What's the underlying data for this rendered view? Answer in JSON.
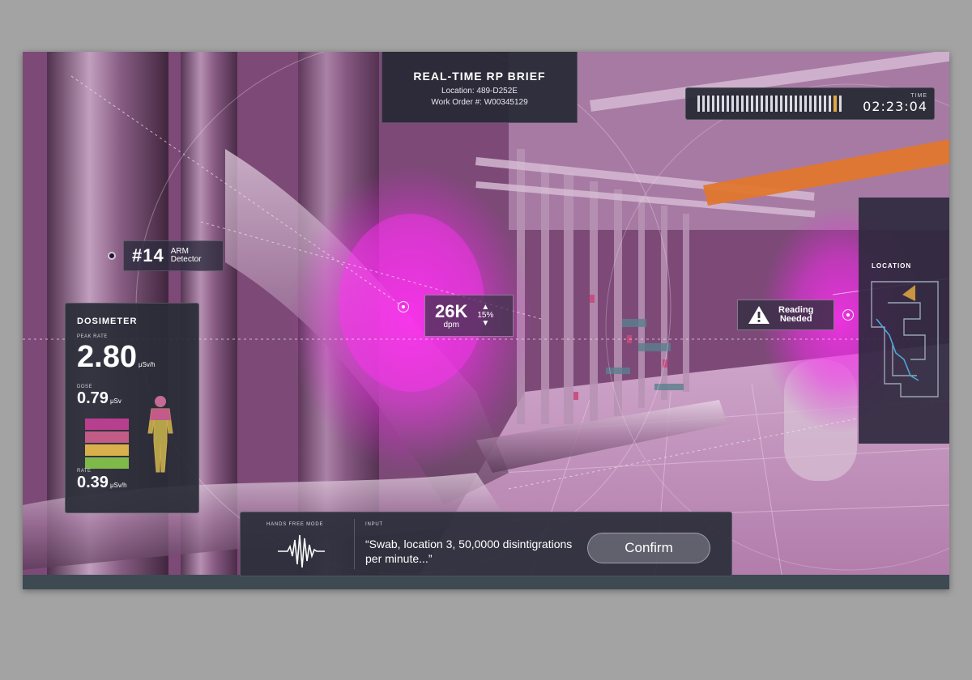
{
  "brief": {
    "title": "REAL-TIME RP BRIEF",
    "location": "Location: 489-D252E",
    "work_order": "Work Order #: W00345129"
  },
  "timer": {
    "label": "TIME",
    "value": "02:23:04",
    "progress": 0.97
  },
  "detector": {
    "number": "#14",
    "label_line1": "ARM",
    "label_line2": "Detector"
  },
  "dosimeter": {
    "title": "DOSIMETER",
    "peak_label": "PEAK RATE",
    "peak_value": "2.80",
    "peak_unit": "μSv/h",
    "dose_label": "DOSE",
    "dose_value": "0.79",
    "dose_unit": "μSv",
    "rate_label": "RATE",
    "rate_value": "0.39",
    "rate_unit": "μSv/h",
    "meter_colors": [
      "#b83f8f",
      "#c35b87",
      "#d9b04b",
      "#7fb94a"
    ]
  },
  "reading_point": {
    "value": "26K",
    "unit": "dpm",
    "delta": "15%"
  },
  "alert": {
    "line1": "Reading",
    "line2": "Needed",
    "icon": "warning-icon"
  },
  "location_panel": {
    "label": "LOCATION"
  },
  "voice": {
    "mode_label": "HANDS FREE MODE",
    "input_label": "INPUT",
    "input_text": "“Swab, location 3, 50,0000 disintigrations per minute...”",
    "confirm_label": "Confirm"
  },
  "colors": {
    "overlay_magenta": "#e020d8",
    "pipe_orange": "#e0772e",
    "panel_dark": "#282c38",
    "timer_accent": "#e2a940"
  }
}
